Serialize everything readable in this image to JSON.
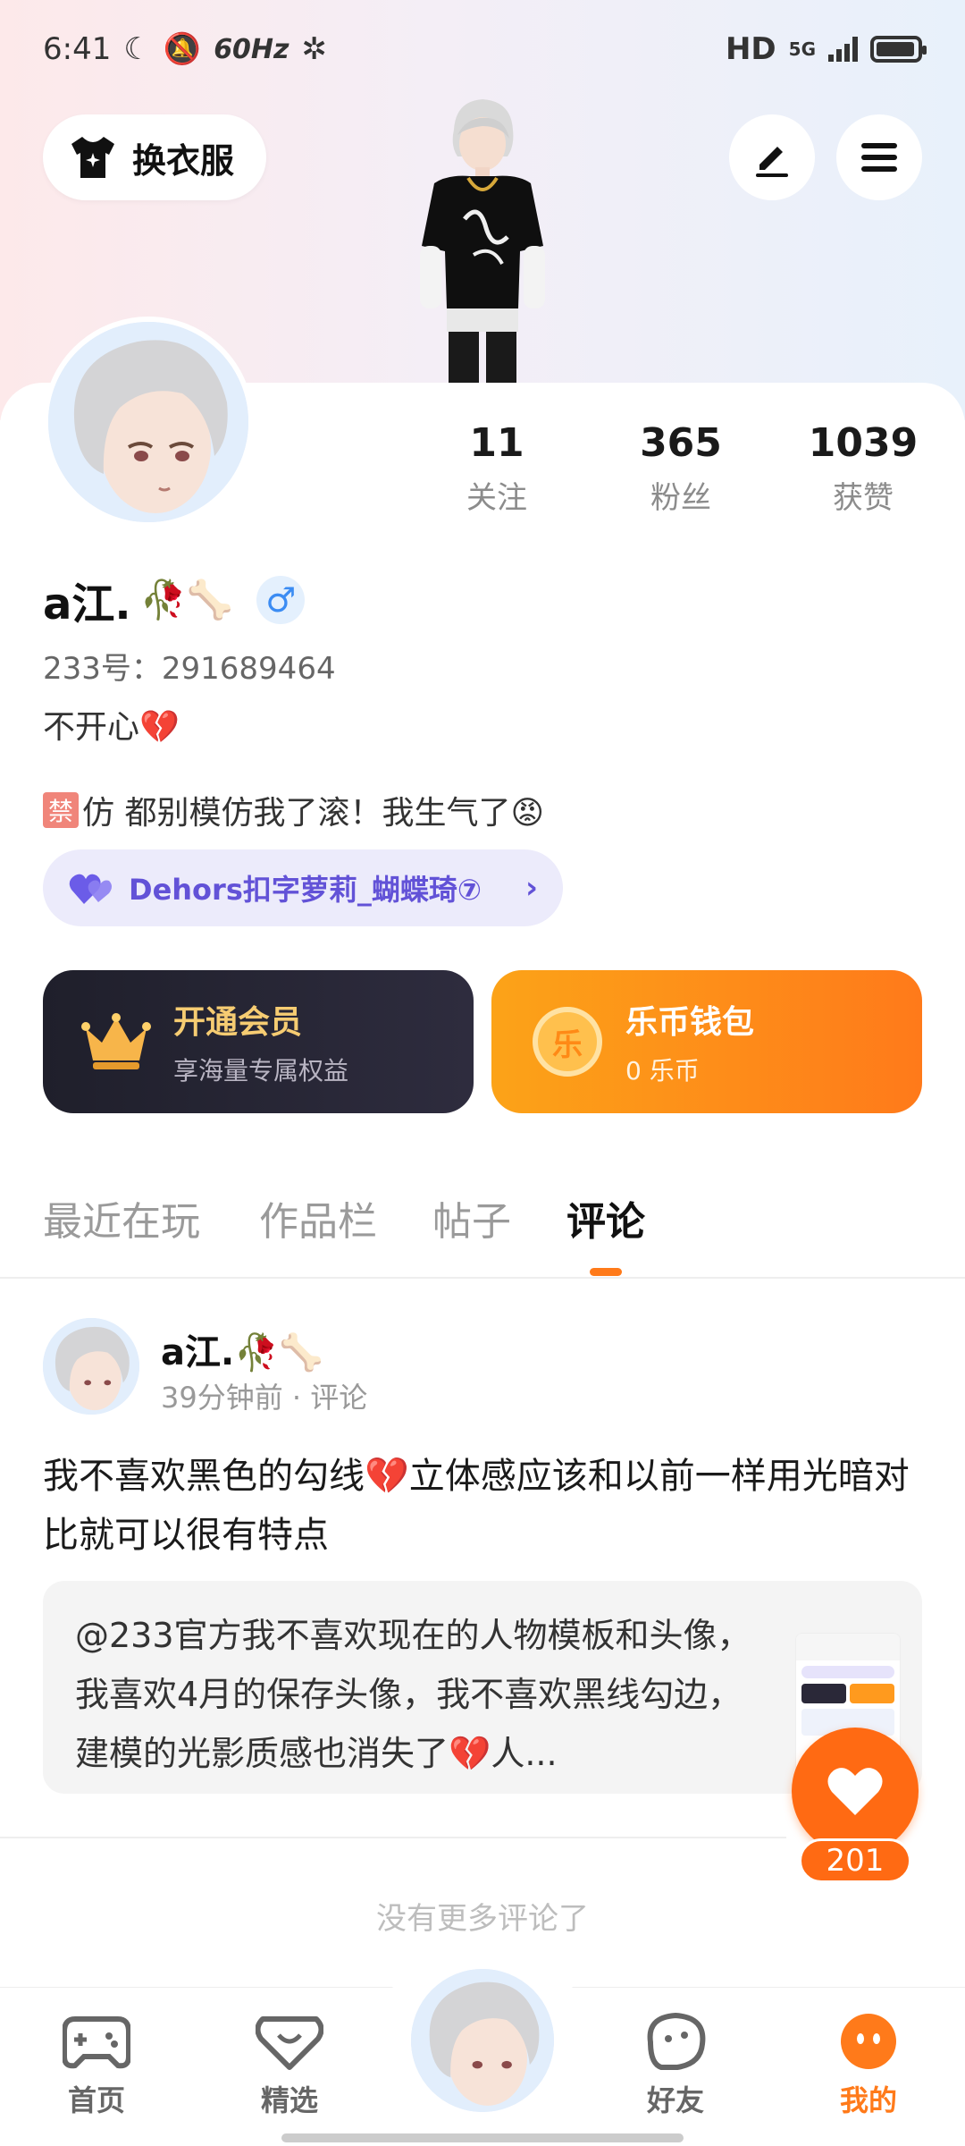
{
  "status_bar": {
    "time": "6:41",
    "refresh": "60Hz",
    "network": "HD",
    "signal_label": "5G"
  },
  "header": {
    "outfit_label": "换衣服",
    "edit_icon": "pencil-icon",
    "menu_icon": "hamburger-menu-icon"
  },
  "stats": [
    {
      "value": "11",
      "label": "关注"
    },
    {
      "value": "365",
      "label": "粉丝"
    },
    {
      "value": "1039",
      "label": "获赞"
    }
  ],
  "profile": {
    "nickname": "a江.",
    "nickname_emojis": "🥀🦴",
    "gender_symbol": "♂",
    "uid": "233号：291689464",
    "signature_1": "不开心💔",
    "ban_char": "禁",
    "signature_2": "仿 都别模仿我了滚！我生气了😡",
    "guild": "Dehors扣字萝莉_蝴蝶琦⑦"
  },
  "cards": {
    "vip_title": "开通会员",
    "vip_sub": "享海量专属权益",
    "wallet_title": "乐币钱包",
    "wallet_sub": "0 乐币",
    "coin_char": "乐"
  },
  "tabs": [
    "最近在玩",
    "作品栏",
    "帖子",
    "评论"
  ],
  "active_tab": "评论",
  "comment": {
    "author": "a江.🥀🦴",
    "meta": "39分钟前 · 评论",
    "body": "我不喜欢黑色的勾线💔立体感应该和以前一样用光暗对比就可以很有特点",
    "quote": "@233官方我不喜欢现在的人物模板和头像，我喜欢4月的保存头像，我不喜欢黑线勾边，建模的光影质感也消失了💔人...",
    "likes": "201"
  },
  "footer_note": "没有更多评论了",
  "nav": [
    {
      "label": "首页",
      "icon": "gamepad-icon"
    },
    {
      "label": "精选",
      "icon": "heart-shield-icon"
    },
    {
      "label": "好友",
      "icon": "friend-face-icon"
    },
    {
      "label": "我的",
      "icon": "me-face-icon"
    }
  ],
  "colors": {
    "accent": "#ff7a1a",
    "guild": "#6252d7",
    "vip_gold": "#f6cc72"
  }
}
